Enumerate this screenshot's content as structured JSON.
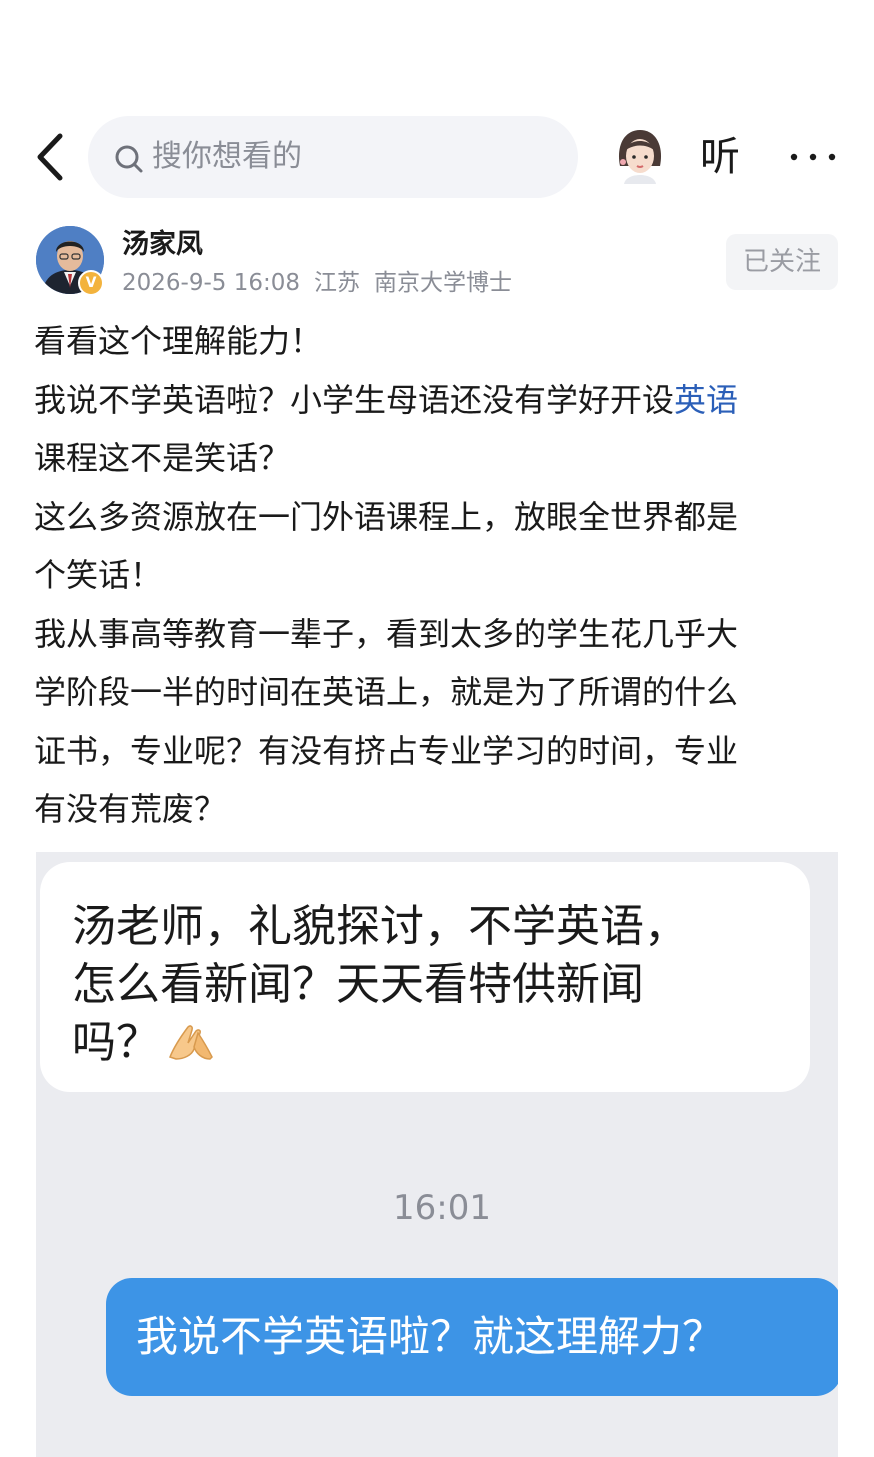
{
  "header": {
    "search_placeholder": "搜你想看的",
    "listen_label": "听"
  },
  "author": {
    "name": "汤家凤",
    "date": "2026-9-5 16:08",
    "location": "江苏",
    "title": "南京大学博士",
    "badge": "V",
    "follow_label": "已关注"
  },
  "post": {
    "line1": "看看这个理解能力！",
    "line2_pre": "我说不学英语啦？小学生母语还没有学好开设",
    "line2_kw": "英语",
    "line3": "课程这不是笑话？",
    "line4": "这么多资源放在一门外语课程上，放眼全世界都是",
    "line5": "个笑话！",
    "line6": "我从事高等教育一辈子，看到太多的学生花几乎大",
    "line7": "学阶段一半的时间在英语上，就是为了所谓的什么",
    "line8": "证书，专业呢？有没有挤占专业学习的时间，专业",
    "line9": "有没有荒废？"
  },
  "screenshot": {
    "incoming_line1": "汤老师，礼貌探讨，不学英语，",
    "incoming_line2": "怎么看新闻？天天看特供新闻",
    "incoming_line3": "吗？",
    "emoji_name": "folded-hands-emoji",
    "time": "16:01",
    "outgoing": "我说不学英语啦？就这理解力？"
  },
  "colors": {
    "keyword": "#2b5fb8",
    "outgoing_bubble": "#3d94e6",
    "screenshot_bg": "#ebecf0"
  }
}
